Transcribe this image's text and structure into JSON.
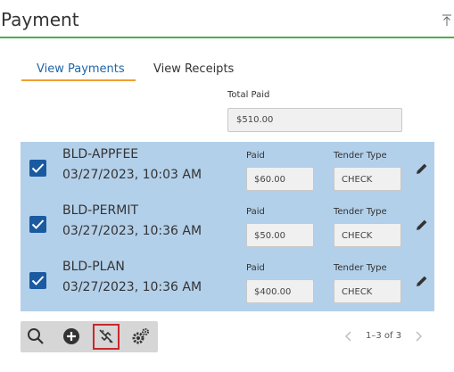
{
  "header": {
    "title": "Payment",
    "collapse_icon": "collapse-up-icon"
  },
  "tabs": [
    {
      "label": "View Payments",
      "active": true
    },
    {
      "label": "View Receipts",
      "active": false
    }
  ],
  "total": {
    "label": "Total Paid",
    "value": "$510.00"
  },
  "payments": [
    {
      "code": "BLD-APPFEE",
      "date": "03/27/2023, 10:03 AM",
      "paid_label": "Paid",
      "paid": "$60.00",
      "tender_label": "Tender Type",
      "tender": "CHECK",
      "checked": true
    },
    {
      "code": "BLD-PERMIT",
      "date": "03/27/2023, 10:36 AM",
      "paid_label": "Paid",
      "paid": "$50.00",
      "tender_label": "Tender Type",
      "tender": "CHECK",
      "checked": true
    },
    {
      "code": "BLD-PLAN",
      "date": "03/27/2023, 10:36 AM",
      "paid_label": "Paid",
      "paid": "$400.00",
      "tender_label": "Tender Type",
      "tender": "CHECK",
      "checked": true
    }
  ],
  "toolbar": {
    "icons": [
      "search-icon",
      "add-icon",
      "unlink-icon",
      "settings-icon"
    ],
    "highlighted": "unlink-icon"
  },
  "pager": {
    "text": "1–3 of 3"
  },
  "colors": {
    "accent_line": "#4caf50",
    "tab_active": "#1e66a8",
    "tab_underline": "#f0a030",
    "list_bg": "#b3d0ea",
    "checkbox": "#1a5aa0",
    "highlight_border": "#c8282c"
  }
}
